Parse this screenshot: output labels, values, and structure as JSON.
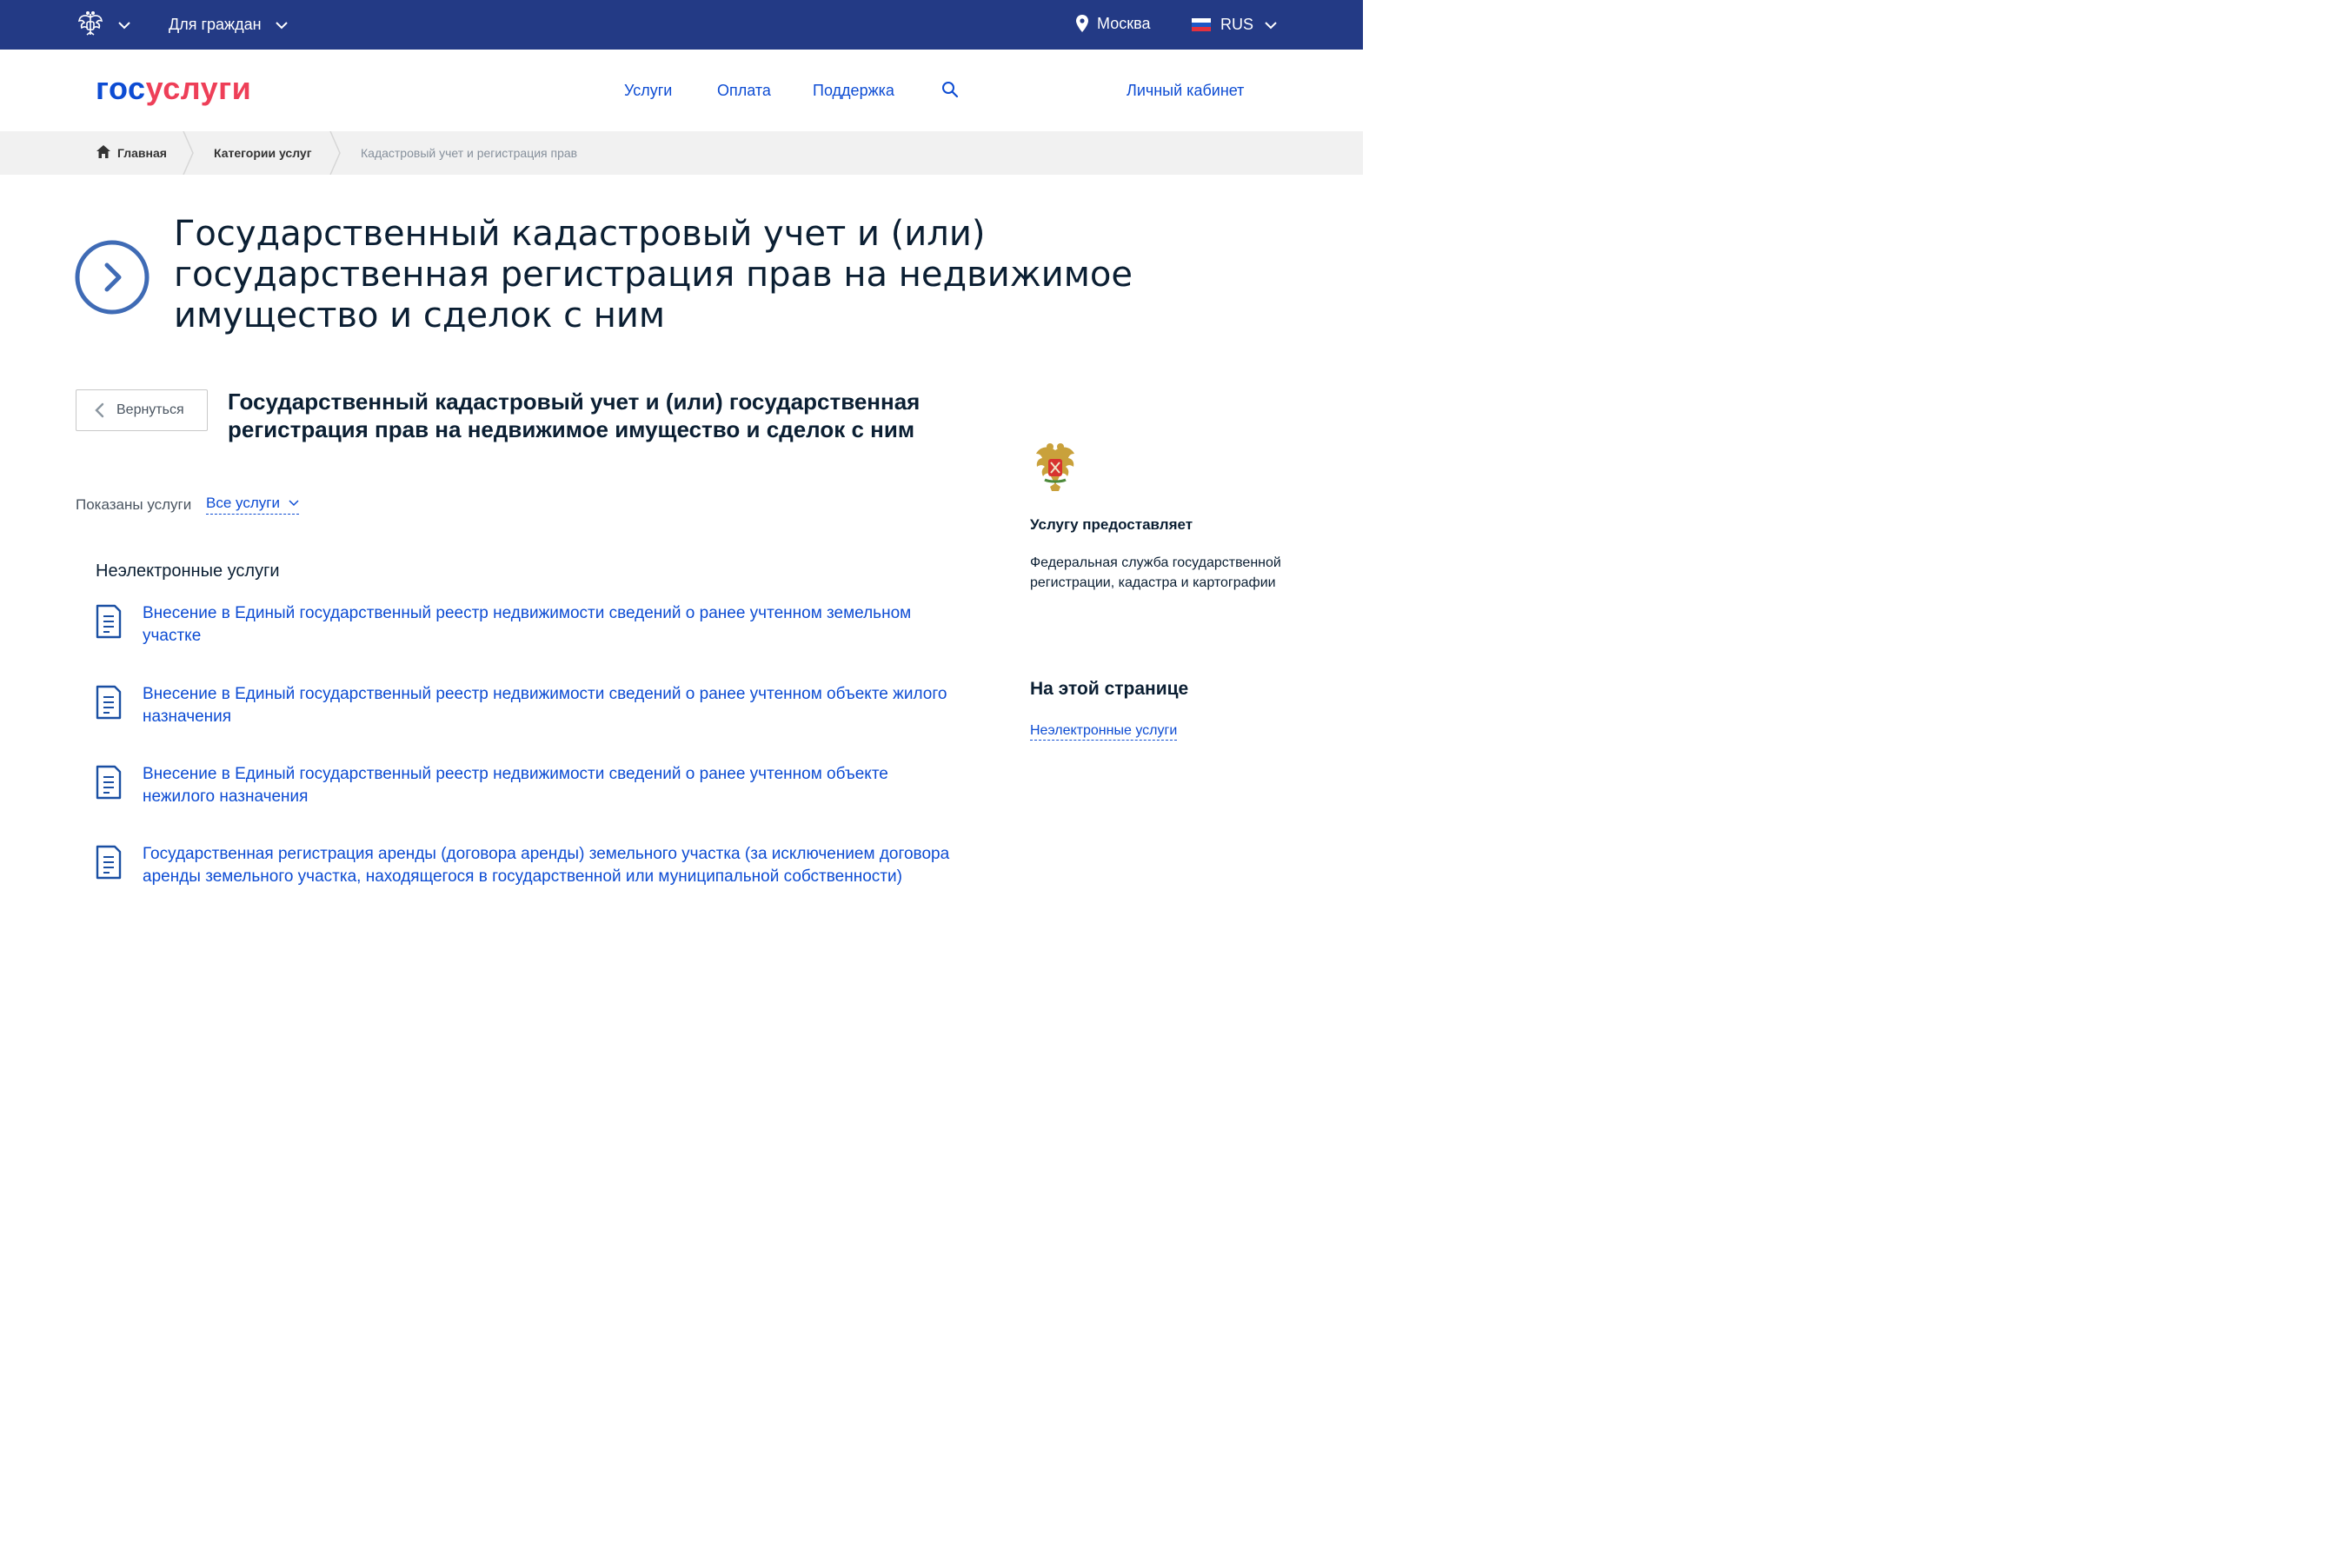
{
  "topbar": {
    "audience": "Для граждан",
    "city": "Москва",
    "language": "RUS",
    "icons": [
      "emblem-icon",
      "chevron-down-icon",
      "location-pin-icon",
      "flag-ru-icon"
    ]
  },
  "header": {
    "logo_part1": "гос",
    "logo_part2": "услуги",
    "nav": [
      "Услуги",
      "Оплата",
      "Поддержка"
    ],
    "cabinet": "Личный кабинет",
    "search_icon": "search-icon"
  },
  "breadcrumbs": {
    "home": "Главная",
    "categories": "Категории услуг",
    "current": "Кадастровый учет и регистрация прав"
  },
  "page": {
    "title": "Государственный кадастровый учет и (или) государственная регистрация прав на недвижимое имущество и сделок с ним",
    "back": "Вернуться",
    "subtitle": "Государственный кадастровый учет и (или) государственная регистрация прав на недвижимое имущество и сделок с ним",
    "shown_label": "Показаны услуги",
    "shown_value": "Все услуги",
    "section_title": "Неэлектронные услуги",
    "services": [
      "Внесение в Единый государственный реестр недвижимости сведений о ранее учтенном земельном участке",
      "Внесение в Единый государственный реестр недвижимости сведений о ранее учтенном объекте жилого назначения",
      "Внесение в Единый государственный реестр недвижимости сведений о ранее учтенном объекте нежилого назначения",
      "Государственная регистрация аренды (договора аренды) земельного участка (за исключением договора аренды земельного участка, находящегося в государственной или муниципальной собственности)"
    ]
  },
  "sidebar": {
    "provider_label": "Услугу предоставляет",
    "provider_name": "Федеральная служба государственной регистрации, кадастра и картографии",
    "onpage_title": "На этой странице",
    "onpage_link": "Неэлектронные услуги"
  },
  "colors": {
    "topbar": "#233a85",
    "link": "#0d4cd3",
    "logo_red": "#ee3f58",
    "breadcrumb_bg": "#f1f1f1",
    "text": "#0b1f33"
  }
}
